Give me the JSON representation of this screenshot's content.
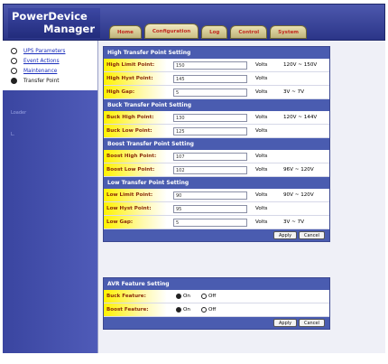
{
  "header": {
    "brand_line1": "PowerDevice",
    "brand_line2": "Manager"
  },
  "tabs": [
    {
      "label": "Home",
      "active": false
    },
    {
      "label": "Configuration",
      "active": true
    },
    {
      "label": "Log",
      "active": false
    },
    {
      "label": "Control",
      "active": false
    },
    {
      "label": "System",
      "active": false
    }
  ],
  "sidebar": {
    "items": [
      {
        "label": "UPS Parameters",
        "selected": false
      },
      {
        "label": "Event Actions",
        "selected": false
      },
      {
        "label": "Maintenance",
        "selected": false
      },
      {
        "label": "Transfer Point",
        "selected": true
      }
    ],
    "tag1": "Loader",
    "tag2": "L."
  },
  "transfer": {
    "high": {
      "title": "High Transfer Point Setting",
      "rows": [
        {
          "label": "High Limit Point:",
          "value": "150",
          "unit": "Volts",
          "range": "120V ~ 150V"
        },
        {
          "label": "High Hyst Point:",
          "value": "145",
          "unit": "Volts",
          "range": ""
        },
        {
          "label": "High Gap:",
          "value": "5",
          "unit": "Volts",
          "range": "3V ~ 7V"
        }
      ]
    },
    "buck": {
      "title": "Buck Transfer Point Setting",
      "rows": [
        {
          "label": "Buck High Point:",
          "value": "130",
          "unit": "Volts",
          "range": "120V ~ 144V"
        },
        {
          "label": "Buck Low Point:",
          "value": "125",
          "unit": "Volts",
          "range": ""
        }
      ]
    },
    "boost": {
      "title": "Boost Transfer Point Setting",
      "rows": [
        {
          "label": "Boost High Point:",
          "value": "107",
          "unit": "Volts",
          "range": ""
        },
        {
          "label": "Boost Low Point:",
          "value": "102",
          "unit": "Volts",
          "range": "96V ~ 120V"
        }
      ]
    },
    "low": {
      "title": "Low Transfer Point Setting",
      "rows": [
        {
          "label": "Low Limit Point:",
          "value": "90",
          "unit": "Volts",
          "range": "90V ~ 120V"
        },
        {
          "label": "Low Hyst Point:",
          "value": "95",
          "unit": "Volts",
          "range": ""
        },
        {
          "label": "Low Gap:",
          "value": "5",
          "unit": "Volts",
          "range": "3V ~ 7V"
        }
      ]
    },
    "apply_label": "Apply",
    "cancel_label": "Cancel"
  },
  "avr": {
    "title": "AVR Feature Setting",
    "rows": [
      {
        "label": "Buck Feature:",
        "on_label": "On",
        "off_label": "Off",
        "selected": "On"
      },
      {
        "label": "Boost Feature:",
        "on_label": "On",
        "off_label": "Off",
        "selected": "On"
      }
    ],
    "apply_label": "Apply",
    "cancel_label": "Cancel"
  }
}
